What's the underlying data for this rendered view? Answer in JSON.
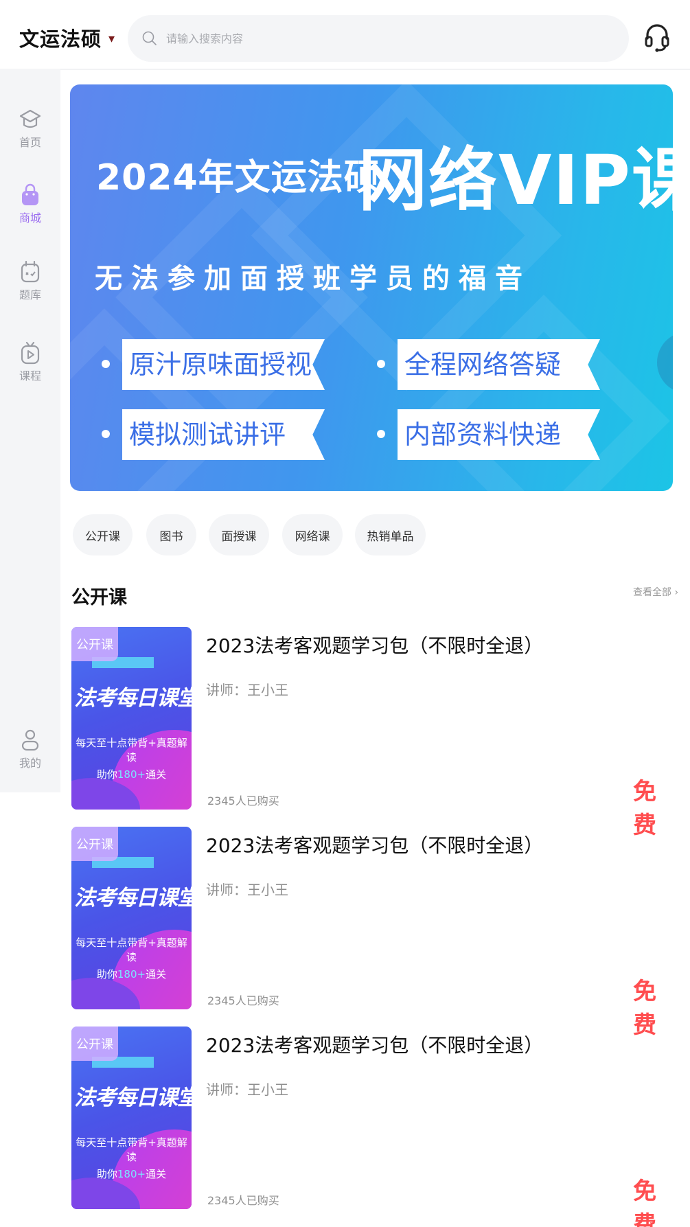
{
  "header": {
    "brand": "文运法硕",
    "search_placeholder": "请输入搜索内容"
  },
  "sidebar": {
    "items": [
      {
        "label": "首页",
        "icon": "graduation-cap-icon",
        "active": false
      },
      {
        "label": "商城",
        "icon": "shopping-bag-icon",
        "active": true
      },
      {
        "label": "题库",
        "icon": "question-bank-icon",
        "active": false
      },
      {
        "label": "课程",
        "icon": "tv-play-icon",
        "active": false
      },
      {
        "label": "我的",
        "icon": "user-icon",
        "active": false
      }
    ]
  },
  "banner": {
    "title_prefix": "2024年文运法硕",
    "title_main": "网络VIP课程",
    "subtitle": "无法参加面授班学员的福音",
    "features": [
      "原汁原味面授视频",
      "全程网络答疑",
      "模拟测试讲评",
      "内部资料快递"
    ]
  },
  "tabs": [
    "公开课",
    "图书",
    "面授课",
    "网络课",
    "热销单品"
  ],
  "section": {
    "title": "公开课",
    "view_all": "查看全部 ›"
  },
  "courses": [
    {
      "badge": "公开课",
      "thumb_heading": "法考每日课堂",
      "thumb_line1": "每天至十点带背+真题解读",
      "thumb_line2_prefix": "助你",
      "thumb_line2_highlight": "180+",
      "thumb_line2_suffix": "通关",
      "title": "2023法考客观题学习包（不限时全退）",
      "teacher": "讲师：王小王",
      "buyers": "2345人已购买",
      "price": "免费"
    },
    {
      "badge": "公开课",
      "thumb_heading": "法考每日课堂",
      "thumb_line1": "每天至十点带背+真题解读",
      "thumb_line2_prefix": "助你",
      "thumb_line2_highlight": "180+",
      "thumb_line2_suffix": "通关",
      "title": "2023法考客观题学习包（不限时全退）",
      "teacher": "讲师：王小王",
      "buyers": "2345人已购买",
      "price": "免费"
    },
    {
      "badge": "公开课",
      "thumb_heading": "法考每日课堂",
      "thumb_line1": "每天至十点带背+真题解读",
      "thumb_line2_prefix": "助你",
      "thumb_line2_highlight": "180+",
      "thumb_line2_suffix": "通关",
      "title": "2023法考客观题学习包（不限时全退）",
      "teacher": "讲师：王小王",
      "buyers": "2345人已购买",
      "price": "免费"
    }
  ],
  "colors": {
    "accent": "#9a6cf0",
    "price": "#ff4d4f",
    "banner_start": "#5f86ee",
    "banner_end": "#1cc4e6"
  }
}
